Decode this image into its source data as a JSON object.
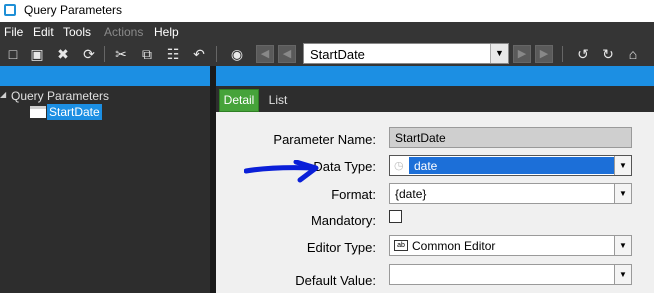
{
  "window": {
    "title": "Query Parameters"
  },
  "menu": {
    "items": [
      "File",
      "Edit",
      "Tools",
      "Actions",
      "Help"
    ]
  },
  "toolbar": {
    "icons": [
      "new-icon",
      "save-icon",
      "delete-icon",
      "refresh-icon",
      "cut-icon",
      "copy-icon",
      "paste-icon",
      "undo-icon",
      "binoculars-icon",
      "first-record-icon",
      "previous-record-icon",
      "next-record-icon",
      "last-record-icon",
      "back-icon",
      "forward-icon",
      "home-icon"
    ],
    "record_select_value": "StartDate"
  },
  "tree": {
    "root_label": "Query Parameters",
    "child_label": "StartDate"
  },
  "tabs": [
    {
      "label": "Detail",
      "active": true
    },
    {
      "label": "List",
      "active": false
    }
  ],
  "form": {
    "parameter_name": {
      "label": "Parameter Name:",
      "value": "StartDate"
    },
    "data_type": {
      "label": "Data Type:",
      "value": "date"
    },
    "format": {
      "label": "Format:",
      "value": "{date}"
    },
    "mandatory": {
      "label": "Mandatory:",
      "checked": false
    },
    "editor_type": {
      "label": "Editor Type:",
      "value": "Common Editor"
    },
    "default_value": {
      "label": "Default Value:",
      "value": ""
    }
  },
  "colors": {
    "accent": "#1c8fe3",
    "tab_active": "#46a33a",
    "annotation_arrow": "#0a1fd8",
    "dark_panel": "#2d2d2d"
  }
}
